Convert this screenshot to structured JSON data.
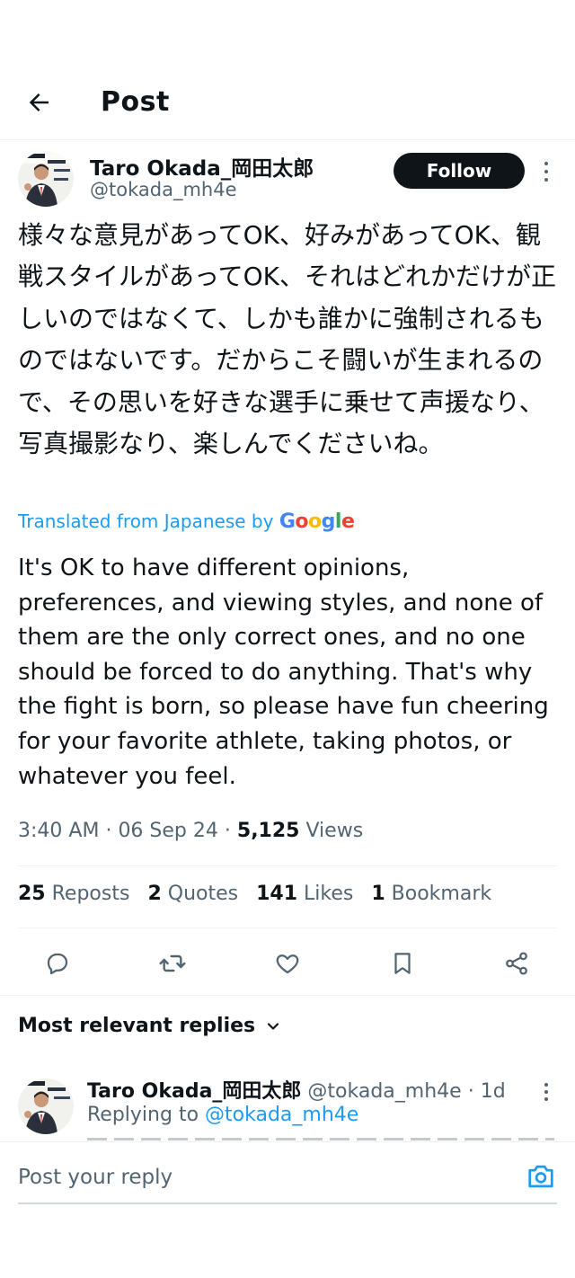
{
  "header": {
    "title": "Post"
  },
  "post": {
    "author_name": "Taro Okada_岡田太郎",
    "author_handle": "@tokada_mh4e",
    "follow_label": "Follow",
    "text_original": "様々な意見があってOK、好みがあってOK、観戦スタイルがあってOK、それはどれかだけが正しいのではなくて、しかも誰かに強制されるものではないです。だからこそ闘いが生まれるので、その思いを好きな選手に乗せて声援なり、写真撮影なり、楽しんでくださいね。",
    "translated_label": "Translated from Japanese by",
    "translation_provider": "Google",
    "text_translated": "It's OK to have different opinions, preferences, and viewing styles, and none of them are the only correct ones, and no one should be forced to do anything. That's why the fight is born, so please have fun cheering for your favorite athlete, taking photos, or whatever you feel.",
    "time": "3:40 AM",
    "date": "06 Sep 24",
    "views_count": "5,125",
    "views_label": "Views"
  },
  "stats": {
    "reposts_count": "25",
    "reposts_label": "Reposts",
    "quotes_count": "2",
    "quotes_label": "Quotes",
    "likes_count": "141",
    "likes_label": "Likes",
    "bookmarks_count": "1",
    "bookmarks_label": "Bookmark"
  },
  "actions": [
    "reply-icon",
    "repost-icon",
    "like-icon",
    "bookmark-icon",
    "share-icon"
  ],
  "replies": {
    "filter_label": "Most relevant replies",
    "items": [
      {
        "author_name": "Taro Okada_岡田太郎",
        "author_handle": "@tokada_mh4e",
        "age": "1d",
        "replying_to_label": "Replying to",
        "replying_to_handle": "@tokada_mh4e"
      }
    ]
  },
  "composer": {
    "placeholder": "Post your reply"
  },
  "colors": {
    "accent": "#1d9bf0",
    "text": "#0f1419",
    "muted": "#536471",
    "divider": "#eff3f4",
    "follow_bg": "#0f1419"
  }
}
